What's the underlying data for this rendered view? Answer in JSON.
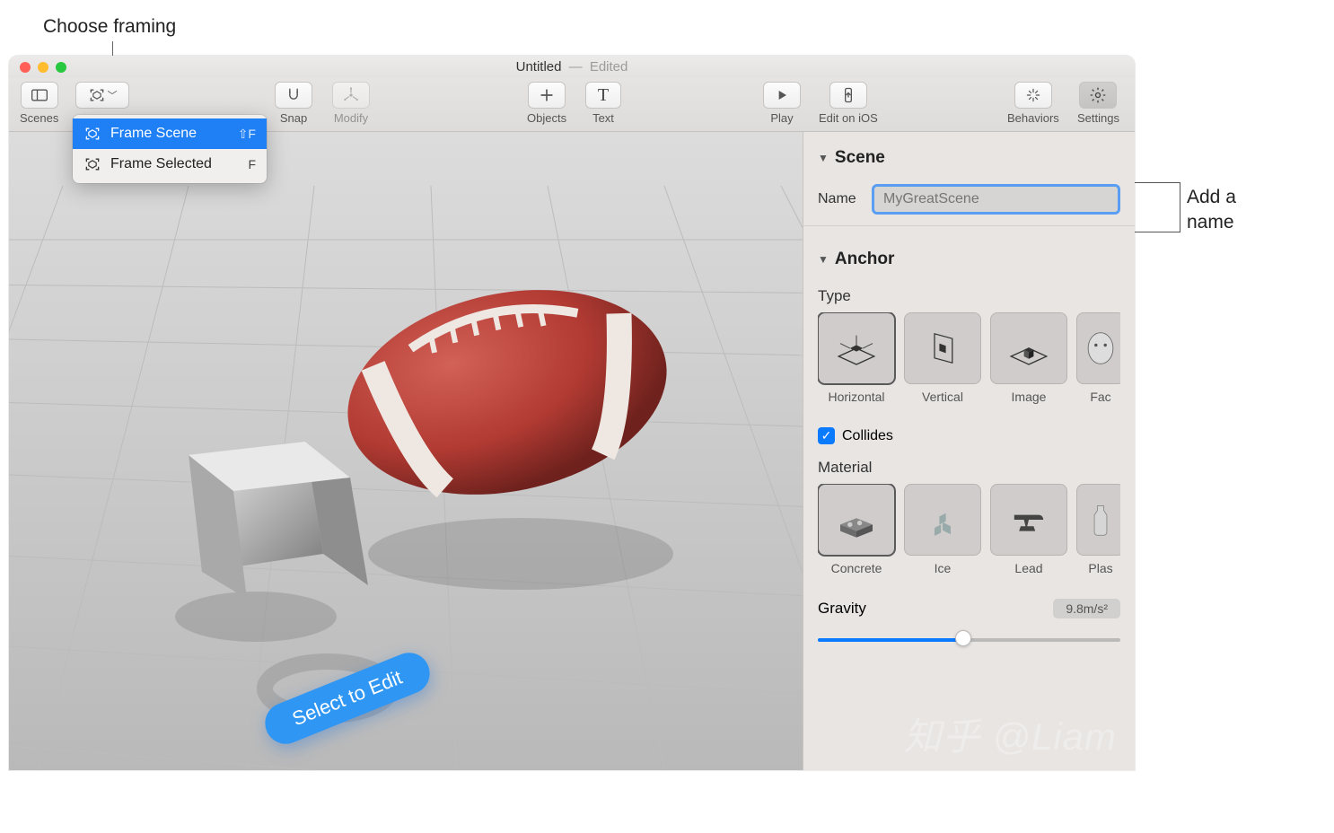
{
  "annotations": {
    "framing": "Choose framing",
    "name": "Add a\nname"
  },
  "window_title": {
    "doc": "Untitled",
    "sep": "—",
    "state": "Edited"
  },
  "toolbar": {
    "scenes": "Scenes",
    "snap": "Snap",
    "modify": "Modify",
    "objects": "Objects",
    "text": "Text",
    "play": "Play",
    "edit_ios": "Edit on iOS",
    "behaviors": "Behaviors",
    "settings": "Settings"
  },
  "framing_menu": {
    "items": [
      {
        "label": "Frame Scene",
        "shortcut": "⇧F",
        "selected": true
      },
      {
        "label": "Frame Selected",
        "shortcut": "F",
        "selected": false
      }
    ]
  },
  "viewport": {
    "floor_badge": "Select to Edit"
  },
  "inspector": {
    "scene": {
      "header": "Scene",
      "name_label": "Name",
      "name_placeholder": "MyGreatScene"
    },
    "anchor": {
      "header": "Anchor",
      "type_label": "Type",
      "types": [
        {
          "label": "Horizontal",
          "selected": true
        },
        {
          "label": "Vertical",
          "selected": false
        },
        {
          "label": "Image",
          "selected": false
        },
        {
          "label": "Fac",
          "selected": false
        }
      ],
      "collides_label": "Collides",
      "collides_checked": true,
      "material_label": "Material",
      "materials": [
        {
          "label": "Concrete",
          "selected": true
        },
        {
          "label": "Ice",
          "selected": false
        },
        {
          "label": "Lead",
          "selected": false
        },
        {
          "label": "Plas",
          "selected": false
        }
      ],
      "gravity_label": "Gravity",
      "gravity_value": "9.8m/s²",
      "gravity_slider_pct": 48
    }
  },
  "watermark": "知乎 @Liam"
}
